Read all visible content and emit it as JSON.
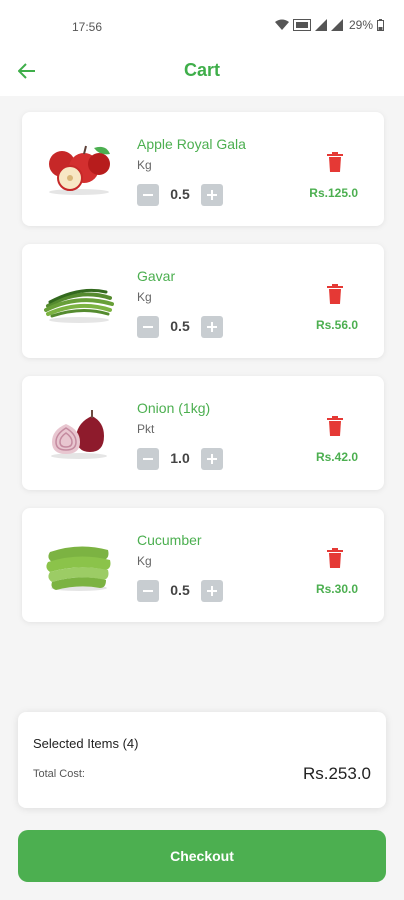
{
  "status_bar": {
    "time": "17:56",
    "battery": "29%"
  },
  "header": {
    "title": "Cart",
    "back_icon": "arrow-left-icon"
  },
  "colors": {
    "accent": "#4caf50",
    "delete": "#e53935",
    "stepper": "#c8cdd1"
  },
  "cart": {
    "items": [
      {
        "name": "Apple Royal Gala",
        "unit": "Kg",
        "quantity": "0.5",
        "price": "Rs.125.0",
        "image": "apple-image"
      },
      {
        "name": "Gavar",
        "unit": "Kg",
        "quantity": "0.5",
        "price": "Rs.56.0",
        "image": "gavar-image"
      },
      {
        "name": "Onion (1kg)",
        "unit": "Pkt",
        "quantity": "1.0",
        "price": "Rs.42.0",
        "image": "onion-image"
      },
      {
        "name": "Cucumber",
        "unit": "Kg",
        "quantity": "0.5",
        "price": "Rs.30.0",
        "image": "cucumber-image"
      }
    ]
  },
  "summary": {
    "selected_items": "Selected Items (4)",
    "total_label": "Total Cost:",
    "total_value": "Rs.253.0"
  },
  "checkout": {
    "label": "Checkout"
  }
}
